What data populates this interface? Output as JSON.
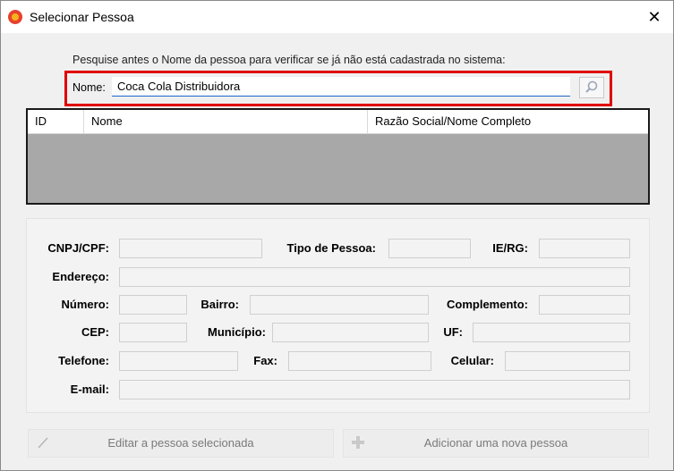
{
  "window": {
    "title": "Selecionar Pessoa"
  },
  "search": {
    "hint": "Pesquise antes o Nome da pessoa para verificar se já não está cadastrada no sistema:",
    "name_label": "Nome:",
    "name_value": "Coca Cola Distribuidora"
  },
  "grid": {
    "columns": [
      "ID",
      "Nome",
      "Razão Social/Nome Completo"
    ]
  },
  "form": {
    "cnpj_cpf": "CNPJ/CPF:",
    "tipo_pessoa": "Tipo de Pessoa:",
    "ie_rg": "IE/RG:",
    "endereco": "Endereço:",
    "numero": "Número:",
    "bairro": "Bairro:",
    "complemento": "Complemento:",
    "cep": "CEP:",
    "municipio": "Município:",
    "uf": "UF:",
    "telefone": "Telefone:",
    "fax": "Fax:",
    "celular": "Celular:",
    "email": "E-mail:"
  },
  "buttons": {
    "edit": "Editar a pessoa selecionada",
    "add": "Adicionar uma nova pessoa"
  },
  "icons": {
    "app": "app-logo-icon",
    "close": "close-icon",
    "search": "magnifier-icon",
    "edit": "pencil-icon",
    "add": "plus-icon"
  },
  "colors": {
    "highlight": "#e00000",
    "input_underline": "#1e66c8",
    "grid_body": "#a8a8a8"
  }
}
